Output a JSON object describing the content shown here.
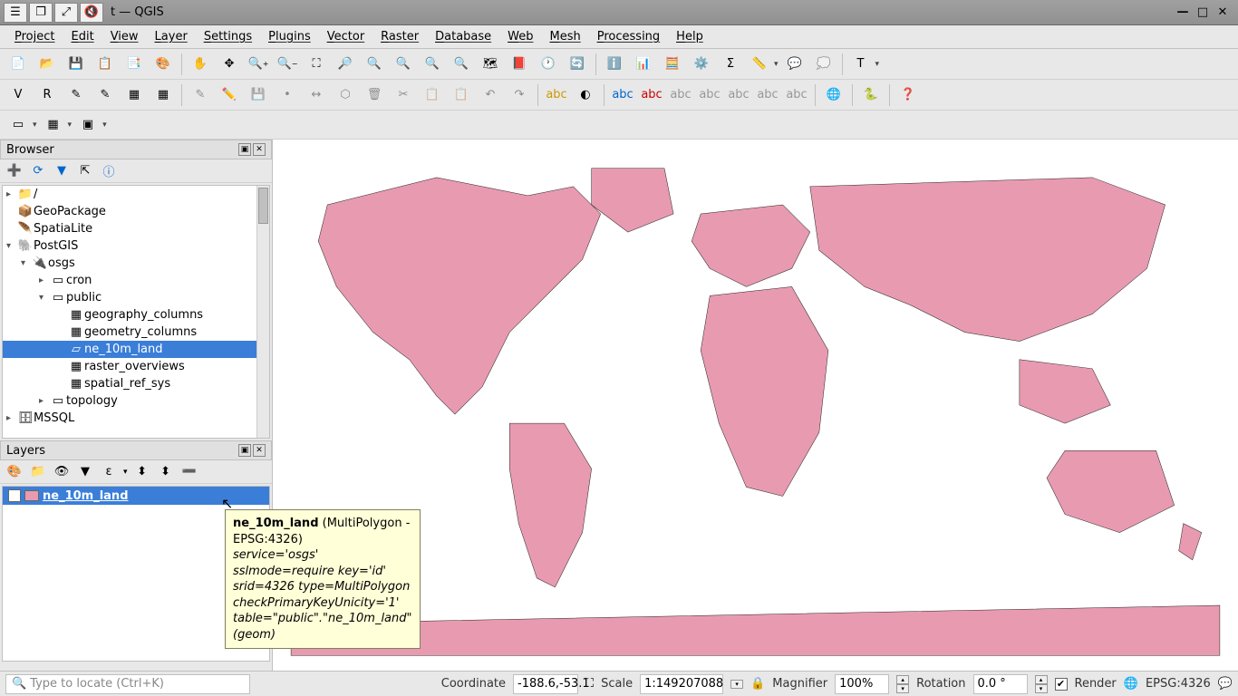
{
  "titlebar": {
    "title": "t — QGIS"
  },
  "menu": [
    "Project",
    "Edit",
    "View",
    "Layer",
    "Settings",
    "Plugins",
    "Vector",
    "Raster",
    "Database",
    "Web",
    "Mesh",
    "Processing",
    "Help"
  ],
  "browser": {
    "title": "Browser",
    "items": {
      "root": "/",
      "geopackage": "GeoPackage",
      "spatialite": "SpatiaLite",
      "postgis": "PostGIS",
      "osgs": "osgs",
      "cron": "cron",
      "public": "public",
      "geo_cols": "geography_columns",
      "geom_cols": "geometry_columns",
      "ne_land": "ne_10m_land",
      "raster_ov": "raster_overviews",
      "spatial_ref": "spatial_ref_sys",
      "topology": "topology",
      "mssql": "MSSQL"
    }
  },
  "layers": {
    "title": "Layers",
    "layer0": {
      "name": "ne_10m_land",
      "checked": true
    }
  },
  "tooltip": {
    "name": "ne_10m_land",
    "extra": " (MultiPolygon - EPSG:4326)",
    "l1": "service='osgs'",
    "l2": "sslmode=require key='id'",
    "l3": "srid=4326 type=MultiPolygon",
    "l4": "checkPrimaryKeyUnicity='1'",
    "l5": "table=\"public\".\"ne_10m_land\" (geom)"
  },
  "status": {
    "locator_placeholder": "Type to locate (Ctrl+K)",
    "coord_label": "Coordinate",
    "coord_value": "-188.6,-53.1",
    "scale_label": "Scale",
    "scale_value": "1:149207088",
    "mag_label": "Magnifier",
    "mag_value": "100%",
    "rot_label": "Rotation",
    "rot_value": "0.0 °",
    "render_label": "Render",
    "crs": "EPSG:4326"
  }
}
